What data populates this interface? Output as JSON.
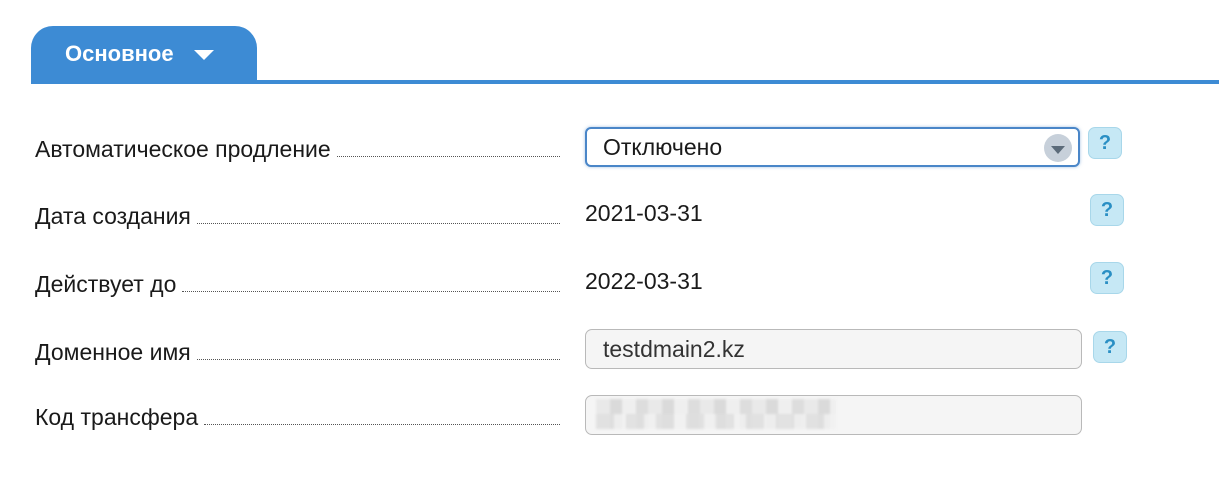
{
  "tab": {
    "label": "Основное"
  },
  "fields": {
    "auto_renew": {
      "label": "Автоматическое продление",
      "value": "Отключено"
    },
    "created": {
      "label": "Дата создания",
      "value": "2021-03-31"
    },
    "valid_until": {
      "label": "Действует до",
      "value": "2022-03-31"
    },
    "domain": {
      "label": "Доменное имя",
      "value": "testdmain2.kz"
    },
    "transfer_code": {
      "label": "Код трансфера",
      "value": ""
    }
  },
  "help": {
    "glyph": "?"
  },
  "colors": {
    "accent": "#3d8bd4",
    "help_bg": "#c6e8f5",
    "help_fg": "#2a8fc4"
  }
}
